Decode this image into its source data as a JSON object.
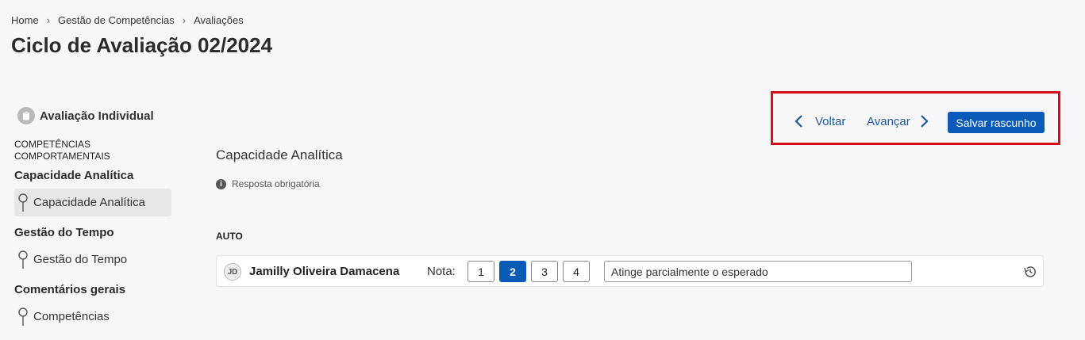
{
  "breadcrumb": [
    "Home",
    "Gestão de Competências",
    "Avaliações"
  ],
  "page_title": "Ciclo de Avaliação 02/2024",
  "sidebar": {
    "header": "Avaliação Individual",
    "section_title": "COMPETÊNCIAS COMPORTAMENTAIS",
    "groups": [
      {
        "title": "Capacidade Analítica",
        "item": "Capacidade Analítica"
      },
      {
        "title": "Gestão do Tempo",
        "item": "Gestão do Tempo"
      },
      {
        "title": "Comentários gerais",
        "item": "Competências"
      }
    ]
  },
  "main": {
    "title": "Capacidade Analítica",
    "required_note": "Resposta obrigatória",
    "section_label": "AUTO",
    "evaluation": {
      "avatar_initials": "JD",
      "person_name": "Jamilly Oliveira Damacena",
      "score_label": "Nota:",
      "scores": [
        "1",
        "2",
        "3",
        "4"
      ],
      "selected_score": "2",
      "score_description": "Atinge parcialmente o esperado"
    }
  },
  "actions": {
    "back_label": "Voltar",
    "next_label": "Avançar",
    "save_draft_label": "Salvar rascunho"
  },
  "colors": {
    "primary": "#0a5bb8",
    "link": "#1c5a9c",
    "highlight_border": "#d40c1c",
    "background": "#f7f7f9"
  }
}
